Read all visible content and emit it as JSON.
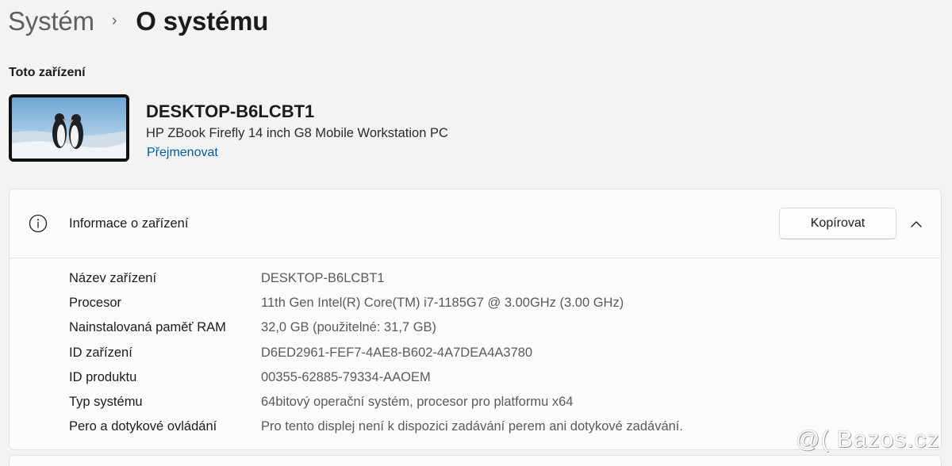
{
  "breadcrumb": {
    "parent": "Systém",
    "separator": "›",
    "current": "O systému"
  },
  "device_section": {
    "label": "Toto zařízení",
    "device_name": "DESKTOP-B6LCBT1",
    "model": "HP ZBook Firefly 14 inch G8 Mobile Workstation PC",
    "rename_link": "Přejmenovat",
    "wallpaper_icon": "penguins-wallpaper"
  },
  "device_info": {
    "icon": "info-icon",
    "title": "Informace o zařízení",
    "copy_button": "Kopírovat",
    "collapse_icon": "chevron-up-icon",
    "specs": [
      {
        "label": "Název zařízení",
        "value": "DESKTOP-B6LCBT1"
      },
      {
        "label": "Procesor",
        "value": "11th Gen Intel(R) Core(TM) i7-1185G7 @ 3.00GHz (3.00 GHz)"
      },
      {
        "label": "Nainstalovaná paměť RAM",
        "value": "32,0 GB (použitelné: 31,7 GB)"
      },
      {
        "label": "ID zařízení",
        "value": "D6ED2961-FEF7-4AE8-B602-4A7DEA4A3780"
      },
      {
        "label": "ID produktu",
        "value": "00355-62885-79334-AAOEM"
      },
      {
        "label": "Typ systému",
        "value": "64bitový operační systém, procesor pro platformu x64"
      },
      {
        "label": "Pero a dotykové ovládání",
        "value": "Pro tento displej není k dispozici zadávání perem ani dotykové zadávání."
      }
    ]
  },
  "watermark": "@( Bazos.cz",
  "colors": {
    "background": "#f3f3f3",
    "card": "#fbfbfb",
    "link": "#005a9e",
    "secondary_text": "#5a5a5a"
  }
}
